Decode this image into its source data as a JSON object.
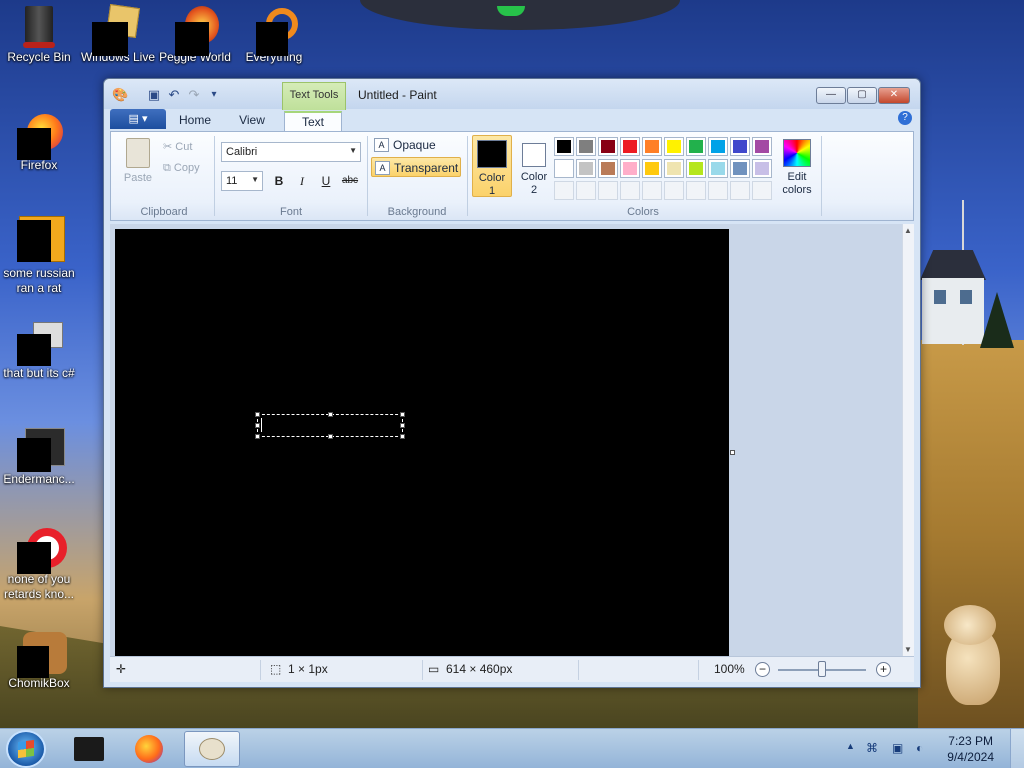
{
  "desktop": {
    "icons": [
      {
        "label": "Recycle Bin"
      },
      {
        "label": "Windows Live"
      },
      {
        "label": "Peggle World"
      },
      {
        "label": "Everything"
      },
      {
        "label": "Firefox"
      },
      {
        "label": "some russian ran a rat"
      },
      {
        "label": "that but its c#"
      },
      {
        "label": "Endermanc..."
      },
      {
        "label": "none of you retards kno..."
      },
      {
        "label": "ChomikBox"
      }
    ]
  },
  "window": {
    "title": "Untitled - Paint",
    "contextual_tab": "Text Tools",
    "buttons": {
      "minimize": "—",
      "maximize": "▢",
      "close": "✕"
    },
    "tabs": [
      {
        "label": "Home"
      },
      {
        "label": "View"
      },
      {
        "label": "Text"
      }
    ],
    "active_tab": "Text",
    "ribbon": {
      "clipboard": {
        "label": "Clipboard",
        "paste": "Paste",
        "cut": "Cut",
        "copy": "Copy"
      },
      "font": {
        "label": "Font",
        "family": "Calibri",
        "size": "11",
        "bold": "B",
        "italic": "I",
        "underline": "U",
        "strikethrough": "abc"
      },
      "background": {
        "label": "Background",
        "opaque": "Opaque",
        "transparent": "Transparent",
        "selected": "Transparent"
      },
      "colors": {
        "label": "Colors",
        "color1": {
          "label1": "Color",
          "label2": "1",
          "value": "#000000"
        },
        "color2": {
          "label1": "Color",
          "label2": "2",
          "value": "#ffffff"
        },
        "edit": {
          "label1": "Edit",
          "label2": "colors"
        },
        "palette_row1": [
          "#000000",
          "#7f7f7f",
          "#880015",
          "#ed1c24",
          "#ff7f27",
          "#fff200",
          "#22b14c",
          "#00a2e8",
          "#3f48cc",
          "#a349a4"
        ],
        "palette_row2": [
          "#ffffff",
          "#c3c3c3",
          "#b97a57",
          "#ffaec9",
          "#ffc90e",
          "#efe4b0",
          "#b5e61d",
          "#99d9ea",
          "#7092be",
          "#c8bfe7"
        ]
      }
    },
    "status": {
      "selection_size": "1 × 1px",
      "image_size": "614 × 460px",
      "zoom": "100%"
    }
  },
  "taskbar": {
    "time": "7:23 PM",
    "date": "9/4/2024"
  }
}
